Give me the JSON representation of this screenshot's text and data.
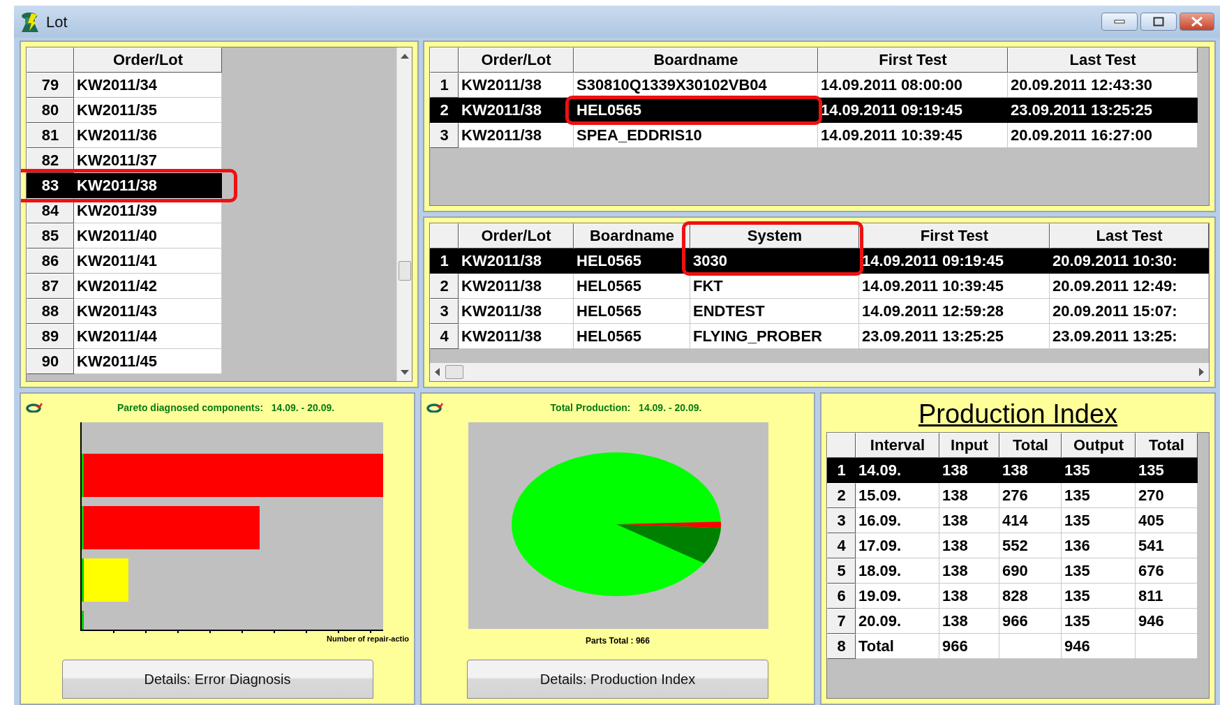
{
  "window": {
    "title": "Lot"
  },
  "lots": {
    "columns": [
      {
        "label": "Order/Lot"
      }
    ],
    "rows": [
      {
        "number": "79",
        "cells": [
          "KW2011/34"
        ],
        "selected": false
      },
      {
        "number": "80",
        "cells": [
          "KW2011/35"
        ],
        "selected": false
      },
      {
        "number": "81",
        "cells": [
          "KW2011/36"
        ],
        "selected": false
      },
      {
        "number": "82",
        "cells": [
          "KW2011/37"
        ],
        "selected": false
      },
      {
        "number": "83",
        "cells": [
          "KW2011/38"
        ],
        "selected": true,
        "highlighted": true
      },
      {
        "number": "84",
        "cells": [
          "KW2011/39"
        ],
        "selected": false
      },
      {
        "number": "85",
        "cells": [
          "KW2011/40"
        ],
        "selected": false
      },
      {
        "number": "86",
        "cells": [
          "KW2011/41"
        ],
        "selected": false
      },
      {
        "number": "87",
        "cells": [
          "KW2011/42"
        ],
        "selected": false
      },
      {
        "number": "88",
        "cells": [
          "KW2011/43"
        ],
        "selected": false
      },
      {
        "number": "89",
        "cells": [
          "KW2011/44"
        ],
        "selected": false
      },
      {
        "number": "90",
        "cells": [
          "KW2011/45"
        ],
        "selected": false
      }
    ]
  },
  "boards": {
    "columns": [
      {
        "label": "Order/Lot"
      },
      {
        "label": "Boardname",
        "highlighted": true
      },
      {
        "label": "First Test"
      },
      {
        "label": "Last Test"
      }
    ],
    "rows": [
      {
        "number": "1",
        "cells": [
          "KW2011/38",
          "S30810Q1339X30102VB04",
          "14.09.2011 08:00:00",
          "20.09.2011 12:43:30"
        ],
        "selected": false
      },
      {
        "number": "2",
        "cells": [
          "KW2011/38",
          "HEL0565",
          "14.09.2011 09:19:45",
          "23.09.2011 13:25:25"
        ],
        "selected": true,
        "highlighted": true
      },
      {
        "number": "3",
        "cells": [
          "KW2011/38",
          "SPEA_EDDRIS10",
          "14.09.2011 10:39:45",
          "20.09.2011 16:27:00"
        ],
        "selected": false
      }
    ]
  },
  "systems": {
    "header_highlighted": true,
    "columns": [
      {
        "label": "Order/Lot"
      },
      {
        "label": "Boardname"
      },
      {
        "label": "System",
        "highlighted": true
      },
      {
        "label": "First Test"
      },
      {
        "label": "Last Test"
      }
    ],
    "rows": [
      {
        "number": "1",
        "cells": [
          "KW2011/38",
          "HEL0565",
          "3030",
          "14.09.2011 09:19:45",
          "20.09.2011 10:30:"
        ],
        "selected": true,
        "highlighted": true
      },
      {
        "number": "2",
        "cells": [
          "KW2011/38",
          "HEL0565",
          "FKT",
          "14.09.2011 10:39:45",
          "20.09.2011 12:49:"
        ],
        "selected": false
      },
      {
        "number": "3",
        "cells": [
          "KW2011/38",
          "HEL0565",
          "ENDTEST",
          "14.09.2011 12:59:28",
          "20.09.2011 15:07:"
        ],
        "selected": false
      },
      {
        "number": "4",
        "cells": [
          "KW2011/38",
          "HEL0565",
          "FLYING_PROBER",
          "23.09.2011 13:25:25",
          "23.09.2011 13:25:"
        ],
        "selected": false
      }
    ]
  },
  "pareto": {
    "title": "Pareto diagnosed components:   14.09. - 20.09.",
    "axis_label": "Number of repair-actio",
    "button": "Details: Error Diagnosis"
  },
  "production": {
    "title": "Total Production:   14.09. - 20.09.",
    "total": "Parts Total : 966",
    "button": "Details: Production Index"
  },
  "production_index": {
    "title": "Production Index",
    "table": {
      "columns": [
        {
          "label": "Interval"
        },
        {
          "label": "Input"
        },
        {
          "label": "Total"
        },
        {
          "label": "Output"
        },
        {
          "label": "Total"
        }
      ],
      "rows": [
        {
          "number": "1",
          "cells": [
            "14.09.",
            "138",
            "138",
            "135",
            "135"
          ],
          "selected": true
        },
        {
          "number": "2",
          "cells": [
            "15.09.",
            "138",
            "276",
            "135",
            "270"
          ],
          "selected": false
        },
        {
          "number": "3",
          "cells": [
            "16.09.",
            "138",
            "414",
            "135",
            "405"
          ],
          "selected": false
        },
        {
          "number": "4",
          "cells": [
            "17.09.",
            "138",
            "552",
            "136",
            "541"
          ],
          "selected": false
        },
        {
          "number": "5",
          "cells": [
            "18.09.",
            "138",
            "690",
            "135",
            "676"
          ],
          "selected": false
        },
        {
          "number": "6",
          "cells": [
            "19.09.",
            "138",
            "828",
            "135",
            "811"
          ],
          "selected": false
        },
        {
          "number": "7",
          "cells": [
            "20.09.",
            "138",
            "966",
            "135",
            "946"
          ],
          "selected": false
        },
        {
          "number": "8",
          "cells": [
            "Total",
            "966",
            null,
            "946",
            null
          ],
          "selected": false
        }
      ]
    }
  }
}
